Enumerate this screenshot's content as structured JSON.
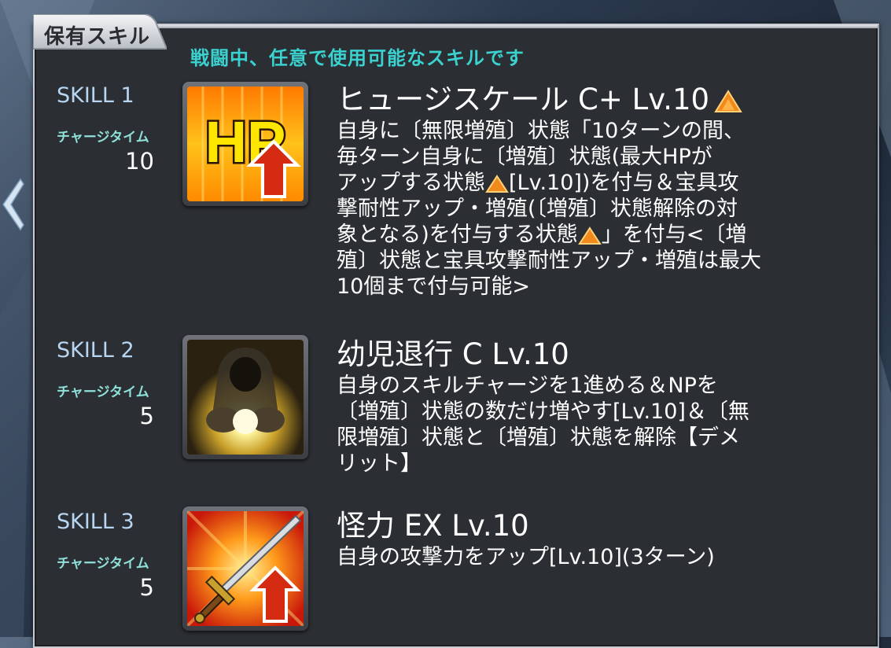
{
  "panel": {
    "tab_label": "保有スキル",
    "subtitle": "戦闘中、任意で使用可能なスキルです"
  },
  "skills": [
    {
      "id_label": "SKILL 1",
      "charge_label": "チャージタイム",
      "charge_value": "10",
      "name": "ヒュージスケール C+ Lv.10",
      "icon": "hp-up-icon",
      "rank_up": true,
      "description": "自身に〔無限増殖〕状態「10ターンの間、\n毎ターン自身に〔増殖〕状態(最大HPが\nアップする状態▲[Lv.10])を付与＆宝具攻\n撃耐性アップ・増殖(〔増殖〕状態解除の対\n象となる)を付与する状態▲」を付与<〔増\n殖〕状態と宝具攻撃耐性アップ・増殖は最大\n10個まで付与可能>"
    },
    {
      "id_label": "SKILL 2",
      "charge_label": "チャージタイム",
      "charge_value": "5",
      "name": "幼児退行 C Lv.10",
      "icon": "hooded-figure-orb-icon",
      "rank_up": false,
      "description": "自身のスキルチャージを1進める＆NPを\n〔増殖〕状態の数だけ増やす[Lv.10]＆〔無\n限増殖〕状態と〔増殖〕状態を解除【デメ\nリット】"
    },
    {
      "id_label": "SKILL 3",
      "charge_label": "チャージタイム",
      "charge_value": "5",
      "name": "怪力 EX Lv.10",
      "icon": "sword-attack-up-icon",
      "rank_up": false,
      "description": "自身の攻撃力をアップ[Lv.10](3ターン)"
    }
  ],
  "colors": {
    "panel_bg": "#2b2e33",
    "subtitle": "#3ad1cf",
    "skill_id": "#b8d6f2",
    "charge_label": "#8fe0d8",
    "text": "#ffffff",
    "rank_up": "#f08a1c"
  }
}
